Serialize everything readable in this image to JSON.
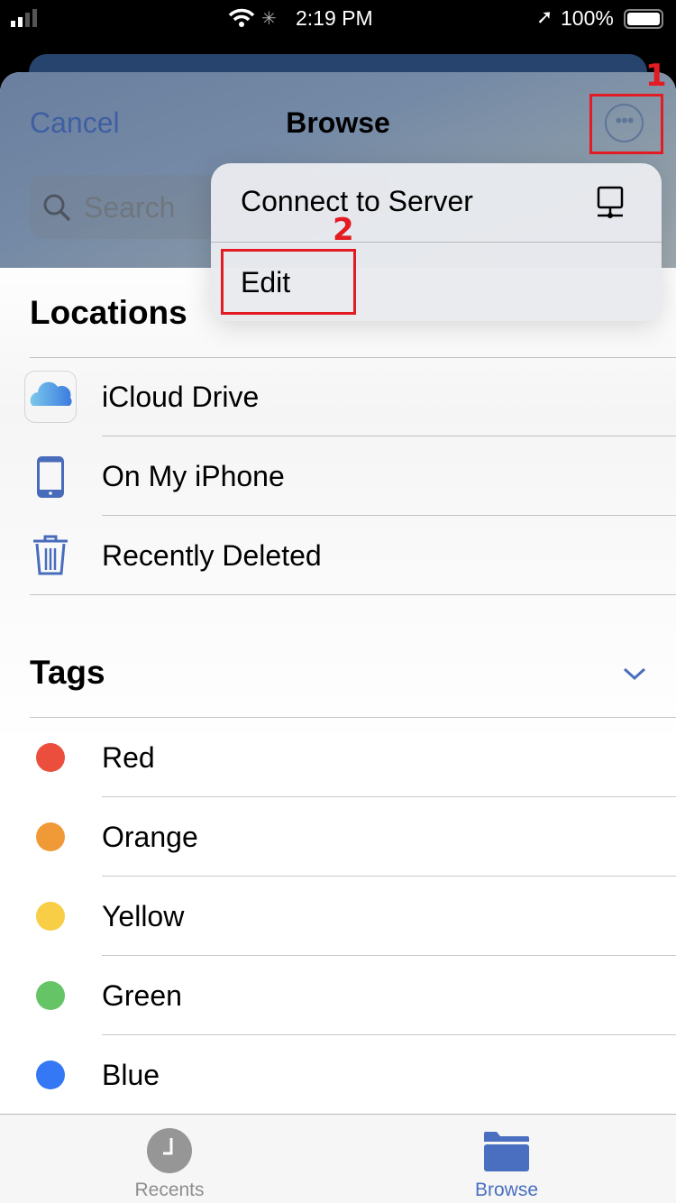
{
  "status_bar": {
    "time": "2:19 PM",
    "battery": "100%"
  },
  "header": {
    "cancel_label": "Cancel",
    "title": "Browse",
    "search_placeholder": "Search"
  },
  "menu": {
    "items": [
      {
        "label": "Connect to Server",
        "icon": "server-icon"
      },
      {
        "label": "Edit"
      }
    ]
  },
  "locations": {
    "heading": "Locations",
    "items": [
      {
        "label": "iCloud Drive",
        "icon": "icloud-icon"
      },
      {
        "label": "On My iPhone",
        "icon": "iphone-icon"
      },
      {
        "label": "Recently Deleted",
        "icon": "trash-icon"
      }
    ]
  },
  "tags": {
    "heading": "Tags",
    "items": [
      {
        "label": "Red",
        "color": "#eb4e3d"
      },
      {
        "label": "Orange",
        "color": "#f09a37"
      },
      {
        "label": "Yellow",
        "color": "#f7ce46"
      },
      {
        "label": "Green",
        "color": "#65c466"
      },
      {
        "label": "Blue",
        "color": "#3478f6"
      }
    ]
  },
  "tabbar": {
    "items": [
      {
        "label": "Recents",
        "icon": "clock-icon",
        "active": false
      },
      {
        "label": "Browse",
        "icon": "folder-icon",
        "active": true
      }
    ]
  },
  "annotations": {
    "step1": "1",
    "step2": "2"
  },
  "colors": {
    "accent": "#4a6fc0",
    "annotation": "#e31b23"
  }
}
